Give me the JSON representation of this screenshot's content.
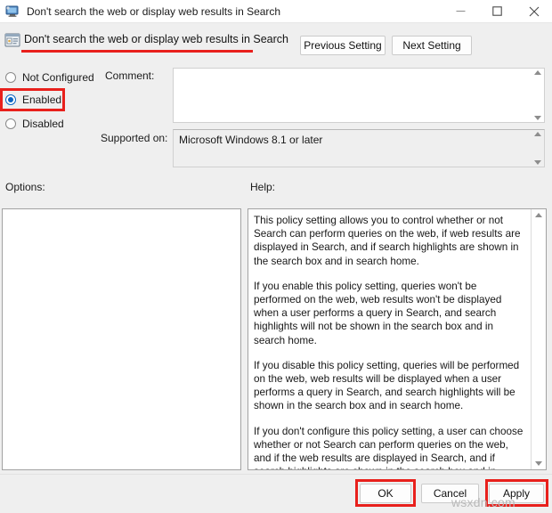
{
  "window": {
    "title": "Don't search the web or display web results in Search",
    "icon": "policy-window-icon",
    "controls": {
      "minimize": "minimize-icon",
      "maximize": "maximize-icon",
      "close": "close-icon"
    }
  },
  "header": {
    "policy_title": "Don't search the web or display web results in Search",
    "policy_icon": "group-policy-icon",
    "previous_setting": "Previous Setting",
    "next_setting": "Next Setting"
  },
  "state_options": [
    {
      "label": "Not Configured",
      "selected": false
    },
    {
      "label": "Enabled",
      "selected": true
    },
    {
      "label": "Disabled",
      "selected": false
    }
  ],
  "fields": {
    "comment_label": "Comment:",
    "comment_value": "",
    "supported_label": "Supported on:",
    "supported_value": "Microsoft Windows 8.1 or later"
  },
  "panels": {
    "options_label": "Options:",
    "options_content": "",
    "help_label": "Help:",
    "help_paragraphs": [
      "This policy setting allows you to control whether or not Search can perform queries on the web, if web results are displayed in Search, and if search highlights are shown in the search box and in search home.",
      "If you enable this policy setting, queries won't be performed on the web, web results won't be displayed when a user performs a query in Search, and search highlights will not be shown in the search box and in search home.",
      "If you disable this policy setting, queries will be performed on the web, web results will be displayed when a user performs a query in Search, and search highlights will be shown in the search box and in search home.",
      "If you don't configure this policy setting, a user can choose whether or not Search can perform queries on the web, and if the web results are displayed in Search, and if search highlights are shown in the search box and in search home."
    ]
  },
  "footer": {
    "ok": "OK",
    "cancel": "Cancel",
    "apply": "Apply"
  },
  "watermark": "wsxdn.com",
  "colors": {
    "highlight": "#e8201c",
    "accent": "#0b65c2",
    "window_bg": "#efefef"
  }
}
